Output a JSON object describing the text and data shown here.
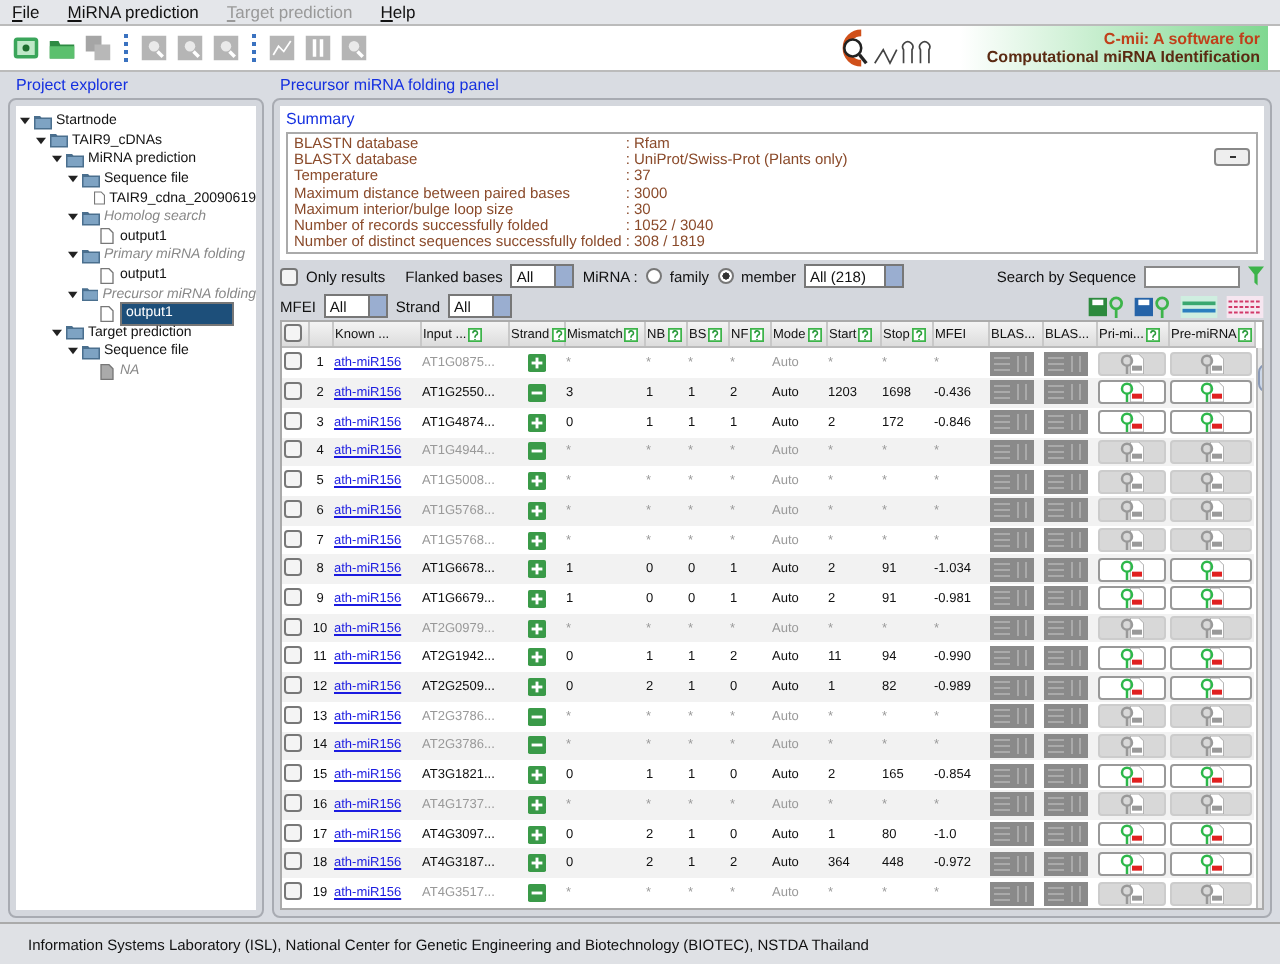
{
  "menu": [
    {
      "label": "File",
      "disabled": false
    },
    {
      "label": "MiRNA prediction",
      "disabled": false
    },
    {
      "label": "Target prediction",
      "disabled": true
    },
    {
      "label": "Help",
      "disabled": false
    }
  ],
  "toolbar": [
    [
      {
        "kind": "new",
        "disabled": false
      },
      {
        "kind": "open",
        "disabled": false
      },
      {
        "kind": "copy",
        "disabled": true
      }
    ],
    [
      {
        "kind": "doc",
        "disabled": true
      },
      {
        "kind": "doc",
        "disabled": true
      },
      {
        "kind": "doc",
        "disabled": true
      }
    ],
    [
      {
        "kind": "chart",
        "disabled": true
      },
      {
        "kind": "bars",
        "disabled": true
      },
      {
        "kind": "doc",
        "disabled": true
      }
    ]
  ],
  "logo": {
    "line1": "C-mii: A software for",
    "line2": "Computational miRNA Identification"
  },
  "explorer": {
    "title": "Project explorer",
    "tree": [
      {
        "label": "Startnode",
        "kind": "folder",
        "expanded": true,
        "disabled": false,
        "selected": false,
        "children": [
          {
            "label": "TAIR9_cDNAs",
            "kind": "folder",
            "expanded": true,
            "disabled": false,
            "selected": false,
            "children": [
              {
                "label": "MiRNA prediction",
                "kind": "folder",
                "expanded": true,
                "disabled": false,
                "selected": false,
                "children": [
                  {
                    "label": "Sequence file",
                    "kind": "folder",
                    "expanded": true,
                    "disabled": false,
                    "selected": false,
                    "children": [
                      {
                        "label": "TAIR9_cdna_20090619",
                        "kind": "file",
                        "disabled": false,
                        "selected": false
                      }
                    ]
                  },
                  {
                    "label": "Homolog search",
                    "kind": "folder",
                    "expanded": true,
                    "disabled": true,
                    "selected": false,
                    "children": [
                      {
                        "label": "output1",
                        "kind": "file",
                        "disabled": false,
                        "selected": false
                      }
                    ]
                  },
                  {
                    "label": "Primary miRNA folding",
                    "kind": "folder",
                    "expanded": true,
                    "disabled": true,
                    "selected": false,
                    "children": [
                      {
                        "label": "output1",
                        "kind": "file",
                        "disabled": false,
                        "selected": false
                      }
                    ]
                  },
                  {
                    "label": "Precursor miRNA folding",
                    "kind": "folder",
                    "expanded": true,
                    "disabled": true,
                    "selected": false,
                    "children": [
                      {
                        "label": "output1",
                        "kind": "file",
                        "disabled": false,
                        "selected": true
                      }
                    ]
                  }
                ]
              },
              {
                "label": "Target prediction",
                "kind": "folder",
                "expanded": true,
                "disabled": false,
                "selected": false,
                "children": [
                  {
                    "label": "Sequence file",
                    "kind": "folder",
                    "expanded": true,
                    "disabled": false,
                    "selected": false,
                    "children": [
                      {
                        "label": "NA",
                        "kind": "file",
                        "disabled": true,
                        "selected": false
                      }
                    ]
                  }
                ]
              }
            ]
          }
        ]
      }
    ]
  },
  "panel": {
    "title": "Precursor miRNA folding panel",
    "summary": {
      "title": "Summary",
      "rows": [
        {
          "label": "BLASTN database",
          "value": ": Rfam"
        },
        {
          "label": "BLASTX database",
          "value": ": UniProt/Swiss-Prot (Plants only)"
        },
        {
          "label": "Temperature",
          "value": ": 37"
        },
        {
          "label": "Maximum distance between paired bases",
          "value": ": 3000"
        },
        {
          "label": "Maximum interior/bulge loop size",
          "value": ": 30"
        },
        {
          "label": "Number of records successfully folded",
          "value": ": 1052 / 3040"
        },
        {
          "label": "Number of distinct sequences successfully folded",
          "value": ": 308 / 1819"
        }
      ]
    }
  },
  "filters": {
    "only_results": {
      "label": "Only results",
      "checked": false
    },
    "flanked_label": "Flanked bases",
    "flanked_value": "All",
    "mirna_label": "MiRNA :",
    "mirna_options": [
      {
        "label": "family",
        "selected": false
      },
      {
        "label": "member",
        "selected": true
      }
    ],
    "mirna_value": "All (218)",
    "search_label": "Search by Sequence",
    "mfei_label": "MFEI",
    "mfei_value": "All",
    "strand_label": "Strand",
    "strand_value": "All"
  },
  "table": {
    "select_all_checked": false,
    "columns": [
      {
        "label": "Known ...",
        "help": false
      },
      {
        "label": "Input ...",
        "help": true
      },
      {
        "label": "Strand",
        "help": true
      },
      {
        "label": "Mismatch",
        "help": true
      },
      {
        "label": "NB",
        "help": true
      },
      {
        "label": "BS",
        "help": true
      },
      {
        "label": "NF",
        "help": true
      },
      {
        "label": "Mode",
        "help": true
      },
      {
        "label": "Start",
        "help": true
      },
      {
        "label": "Stop",
        "help": true
      },
      {
        "label": "MFEI",
        "help": false
      },
      {
        "label": "BLAS...",
        "help": false
      },
      {
        "label": "BLAS...",
        "help": false
      },
      {
        "label": "Pri-mi...",
        "help": true
      },
      {
        "label": "Pre-miRNA",
        "help": true
      }
    ],
    "rows": [
      {
        "checked": false,
        "number": "1",
        "known": "ath-miR156",
        "input": "AT1G0875...",
        "minus": false,
        "active": false,
        "mismatch": "*",
        "nb": "*",
        "bs": "*",
        "nf": "*",
        "mode": "Auto",
        "start": "*",
        "stop": "*",
        "mfei": "*"
      },
      {
        "checked": false,
        "number": "2",
        "known": "ath-miR156",
        "input": "AT1G2550...",
        "minus": true,
        "active": true,
        "mismatch": "3",
        "nb": "1",
        "bs": "1",
        "nf": "2",
        "mode": "Auto",
        "start": "1203",
        "stop": "1698",
        "mfei": "-0.436"
      },
      {
        "checked": false,
        "number": "3",
        "known": "ath-miR156",
        "input": "AT1G4874...",
        "minus": false,
        "active": true,
        "mismatch": "0",
        "nb": "1",
        "bs": "1",
        "nf": "1",
        "mode": "Auto",
        "start": "2",
        "stop": "172",
        "mfei": "-0.846"
      },
      {
        "checked": false,
        "number": "4",
        "known": "ath-miR156",
        "input": "AT1G4944...",
        "minus": true,
        "active": false,
        "mismatch": "*",
        "nb": "*",
        "bs": "*",
        "nf": "*",
        "mode": "Auto",
        "start": "*",
        "stop": "*",
        "mfei": "*"
      },
      {
        "checked": false,
        "number": "5",
        "known": "ath-miR156",
        "input": "AT1G5008...",
        "minus": false,
        "active": false,
        "mismatch": "*",
        "nb": "*",
        "bs": "*",
        "nf": "*",
        "mode": "Auto",
        "start": "*",
        "stop": "*",
        "mfei": "*"
      },
      {
        "checked": false,
        "number": "6",
        "known": "ath-miR156",
        "input": "AT1G5768...",
        "minus": false,
        "active": false,
        "mismatch": "*",
        "nb": "*",
        "bs": "*",
        "nf": "*",
        "mode": "Auto",
        "start": "*",
        "stop": "*",
        "mfei": "*"
      },
      {
        "checked": false,
        "number": "7",
        "known": "ath-miR156",
        "input": "AT1G5768...",
        "minus": false,
        "active": false,
        "mismatch": "*",
        "nb": "*",
        "bs": "*",
        "nf": "*",
        "mode": "Auto",
        "start": "*",
        "stop": "*",
        "mfei": "*"
      },
      {
        "checked": false,
        "number": "8",
        "known": "ath-miR156",
        "input": "AT1G6678...",
        "minus": false,
        "active": true,
        "mismatch": "1",
        "nb": "0",
        "bs": "0",
        "nf": "1",
        "mode": "Auto",
        "start": "2",
        "stop": "91",
        "mfei": "-1.034"
      },
      {
        "checked": false,
        "number": "9",
        "known": "ath-miR156",
        "input": "AT1G6679...",
        "minus": false,
        "active": true,
        "mismatch": "1",
        "nb": "0",
        "bs": "0",
        "nf": "1",
        "mode": "Auto",
        "start": "2",
        "stop": "91",
        "mfei": "-0.981"
      },
      {
        "checked": false,
        "number": "10",
        "known": "ath-miR156",
        "input": "AT2G0979...",
        "minus": false,
        "active": false,
        "mismatch": "*",
        "nb": "*",
        "bs": "*",
        "nf": "*",
        "mode": "Auto",
        "start": "*",
        "stop": "*",
        "mfei": "*"
      },
      {
        "checked": false,
        "number": "11",
        "known": "ath-miR156",
        "input": "AT2G1942...",
        "minus": false,
        "active": true,
        "mismatch": "0",
        "nb": "1",
        "bs": "1",
        "nf": "2",
        "mode": "Auto",
        "start": "11",
        "stop": "94",
        "mfei": "-0.990"
      },
      {
        "checked": false,
        "number": "12",
        "known": "ath-miR156",
        "input": "AT2G2509...",
        "minus": false,
        "active": true,
        "mismatch": "0",
        "nb": "2",
        "bs": "1",
        "nf": "0",
        "mode": "Auto",
        "start": "1",
        "stop": "82",
        "mfei": "-0.989"
      },
      {
        "checked": false,
        "number": "13",
        "known": "ath-miR156",
        "input": "AT2G3786...",
        "minus": true,
        "active": false,
        "mismatch": "*",
        "nb": "*",
        "bs": "*",
        "nf": "*",
        "mode": "Auto",
        "start": "*",
        "stop": "*",
        "mfei": "*"
      },
      {
        "checked": false,
        "number": "14",
        "known": "ath-miR156",
        "input": "AT2G3786...",
        "minus": true,
        "active": false,
        "mismatch": "*",
        "nb": "*",
        "bs": "*",
        "nf": "*",
        "mode": "Auto",
        "start": "*",
        "stop": "*",
        "mfei": "*"
      },
      {
        "checked": false,
        "number": "15",
        "known": "ath-miR156",
        "input": "AT3G1821...",
        "minus": false,
        "active": true,
        "mismatch": "0",
        "nb": "1",
        "bs": "1",
        "nf": "0",
        "mode": "Auto",
        "start": "2",
        "stop": "165",
        "mfei": "-0.854"
      },
      {
        "checked": false,
        "number": "16",
        "known": "ath-miR156",
        "input": "AT4G1737...",
        "minus": false,
        "active": false,
        "mismatch": "*",
        "nb": "*",
        "bs": "*",
        "nf": "*",
        "mode": "Auto",
        "start": "*",
        "stop": "*",
        "mfei": "*"
      },
      {
        "checked": false,
        "number": "17",
        "known": "ath-miR156",
        "input": "AT4G3097...",
        "minus": false,
        "active": true,
        "mismatch": "0",
        "nb": "2",
        "bs": "1",
        "nf": "0",
        "mode": "Auto",
        "start": "1",
        "stop": "80",
        "mfei": "-1.0"
      },
      {
        "checked": false,
        "number": "18",
        "known": "ath-miR156",
        "input": "AT4G3187...",
        "minus": false,
        "active": true,
        "mismatch": "0",
        "nb": "2",
        "bs": "1",
        "nf": "2",
        "mode": "Auto",
        "start": "364",
        "stop": "448",
        "mfei": "-0.972"
      },
      {
        "checked": false,
        "number": "19",
        "known": "ath-miR156",
        "input": "AT4G3517...",
        "minus": true,
        "active": false,
        "mismatch": "*",
        "nb": "*",
        "bs": "*",
        "nf": "*",
        "mode": "Auto",
        "start": "*",
        "stop": "*",
        "mfei": "*"
      }
    ]
  },
  "status_bar": "Information Systems Laboratory (ISL), National Center for Genetic Engineering and Biotechnology (BIOTEC), NSTDA Thailand"
}
